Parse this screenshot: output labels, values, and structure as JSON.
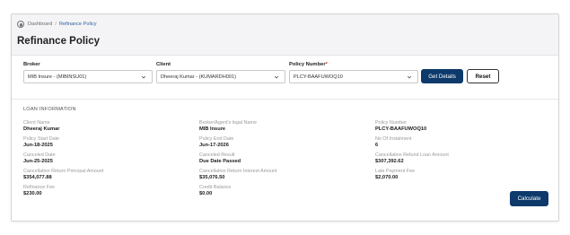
{
  "breadcrumb": {
    "home": "Dashboard",
    "separator": "/",
    "current": "Refinance Policy"
  },
  "page_title": "Refinance Policy",
  "form": {
    "broker": {
      "label": "Broker",
      "value": "MIB Insure - (MIBINSU01)"
    },
    "client": {
      "label": "Client",
      "value": "Dheeraj Kumar - (KUMARDH001)"
    },
    "policy": {
      "label": "Policy Number",
      "required_mark": "*",
      "value": "PLCY-BAAFUWOQ10"
    },
    "get_details_label": "Get Details",
    "reset_label": "Reset"
  },
  "loan_info": {
    "section_title": "LOAN INFORMATION",
    "fields": [
      {
        "label": "Client Name",
        "value": "Dheeraj Kumar"
      },
      {
        "label": "Broker/Agent's legal Name",
        "value": "MIB Insure"
      },
      {
        "label": "Policy Number",
        "value": "PLCY-BAAFUWOQ10"
      },
      {
        "label": "Policy Start Date",
        "value": "Jun-18-2025"
      },
      {
        "label": "Policy End Date",
        "value": "Jun-17-2026"
      },
      {
        "label": "No Of Instalment",
        "value": "6"
      },
      {
        "label": "Canceled Date",
        "value": "Jun-25-2025"
      },
      {
        "label": "Canceled Result",
        "value": "Due Date Passed"
      },
      {
        "label": "Cancellation Refund Loan Amount",
        "value": "$307,392.62"
      },
      {
        "label": "Cancellation Return Principal Amount",
        "value": "$354,077.88"
      },
      {
        "label": "Cancellation Return Interest Amount",
        "value": "$35,076.50"
      },
      {
        "label": "Late Payment Fee",
        "value": "$2,070.00"
      },
      {
        "label": "Refinance Fee",
        "value": "$230.00"
      },
      {
        "label": "Credit Balance",
        "value": "$0.00"
      }
    ]
  },
  "calculate_label": "Calculate",
  "icons": {
    "home": "home-icon",
    "dropdown": "chevron-down-icon"
  },
  "colors": {
    "primary": "#0d3a6b",
    "link": "#2d5fa0",
    "required": "#d32f2f"
  }
}
